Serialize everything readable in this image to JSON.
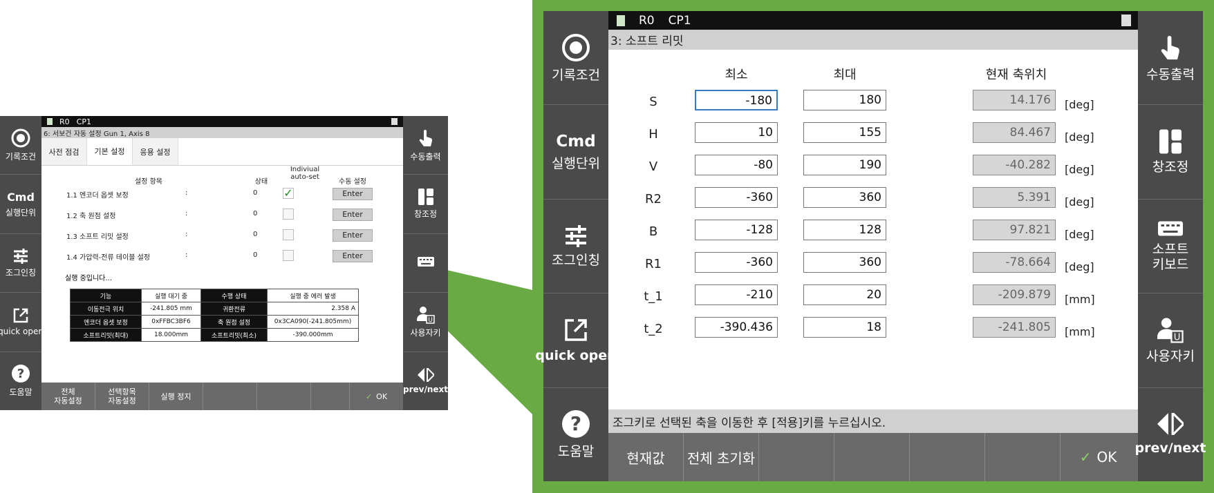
{
  "small_screen": {
    "title": {
      "robot": "R0",
      "program": "CP1"
    },
    "subtitle": "6: 서보건 자동 설정 Gun 1, Axis 8",
    "tabs": [
      "사전 점검",
      "기본 설정",
      "응용 설정"
    ],
    "headers": {
      "item": "설정 항목",
      "state": "상태",
      "auto_line1": "Indiviual",
      "auto_line2": "auto-set",
      "manual": "수동 설정"
    },
    "rows": [
      {
        "label": "1.1 엔코더 옵셋 보정",
        "colon": ":",
        "state": "0",
        "checked": true,
        "button": "Enter"
      },
      {
        "label": "1.2 축 원점 설정",
        "colon": ":",
        "state": "0",
        "checked": false,
        "button": "Enter"
      },
      {
        "label": "1.3 소프트 리밋 설정",
        "colon": ":",
        "state": "0",
        "checked": false,
        "button": "Enter"
      },
      {
        "label": "1.4 가압력-전류 테이블 설정",
        "colon": ":",
        "state": "0",
        "checked": false,
        "button": "Enter"
      }
    ],
    "status": "실행 중입니다...",
    "table": [
      [
        "기능",
        "실행 대기 중",
        "수행 상태",
        "실행 중 에러 발생"
      ],
      [
        "이동전극 위치",
        "-241.805 mm",
        "귀환전류",
        "2.358 A"
      ],
      [
        "엔코더 옵셋 보정",
        "0xFFBC3BF6",
        "축 원점 설정",
        "0x3CA090(-241.805mm)"
      ],
      [
        "소프트리밋(최대)",
        "18.000mm",
        "소프트리밋(최소)",
        "-390.000mm"
      ]
    ],
    "footer": [
      "전체\n자동설정",
      "선택항목\n자동설정",
      "실행 정지",
      "",
      "",
      "OK"
    ],
    "left_sidebar": [
      "기록조건",
      "실행단위",
      "조그인칭",
      "quick open",
      "도움말"
    ],
    "cmd_label": "Cmd",
    "right_sidebar": [
      "수동출력",
      "창조정",
      "",
      "사용자키",
      "prev/next"
    ]
  },
  "large_screen": {
    "title": {
      "robot": "R0",
      "program": "CP1"
    },
    "subtitle": "3: 소프트 리밋",
    "col_min": "최소",
    "col_max": "최대",
    "col_current": "현재 축위치",
    "rows": [
      {
        "axis": "S",
        "min": "-180",
        "max": "180",
        "current": "14.176",
        "unit": "[deg]"
      },
      {
        "axis": "H",
        "min": "10",
        "max": "155",
        "current": "84.467",
        "unit": "[deg]"
      },
      {
        "axis": "V",
        "min": "-80",
        "max": "190",
        "current": "-40.282",
        "unit": "[deg]"
      },
      {
        "axis": "R2",
        "min": "-360",
        "max": "360",
        "current": "5.391",
        "unit": "[deg]"
      },
      {
        "axis": "B",
        "min": "-128",
        "max": "128",
        "current": "97.821",
        "unit": "[deg]"
      },
      {
        "axis": "R1",
        "min": "-360",
        "max": "360",
        "current": "-78.664",
        "unit": "[deg]"
      },
      {
        "axis": "t_1",
        "min": "-210",
        "max": "20",
        "current": "-209.879",
        "unit": "[mm]"
      },
      {
        "axis": "t_2",
        "min": "-390.436",
        "max": "18",
        "current": "-241.805",
        "unit": "[mm]"
      }
    ],
    "hint": "조그키로 선택된 축을 이동한 후 [적용]키를 누르십시오.",
    "footer": [
      "현재값",
      "전체 초기화",
      "",
      "",
      "",
      "",
      "OK"
    ],
    "left_sidebar": [
      "기록조건",
      "실행단위",
      "조그인칭",
      "quick open",
      "도움말"
    ],
    "cmd_label": "Cmd",
    "right_sidebar": [
      "수동출력",
      "창조정",
      "소프트\n키보드",
      "사용자키",
      "prev/next"
    ]
  },
  "colors": {
    "accent_green": "#6aaa45",
    "panel_dark": "#4a4a4a",
    "title_black": "#111111",
    "check_green": "#1a8c1a"
  }
}
